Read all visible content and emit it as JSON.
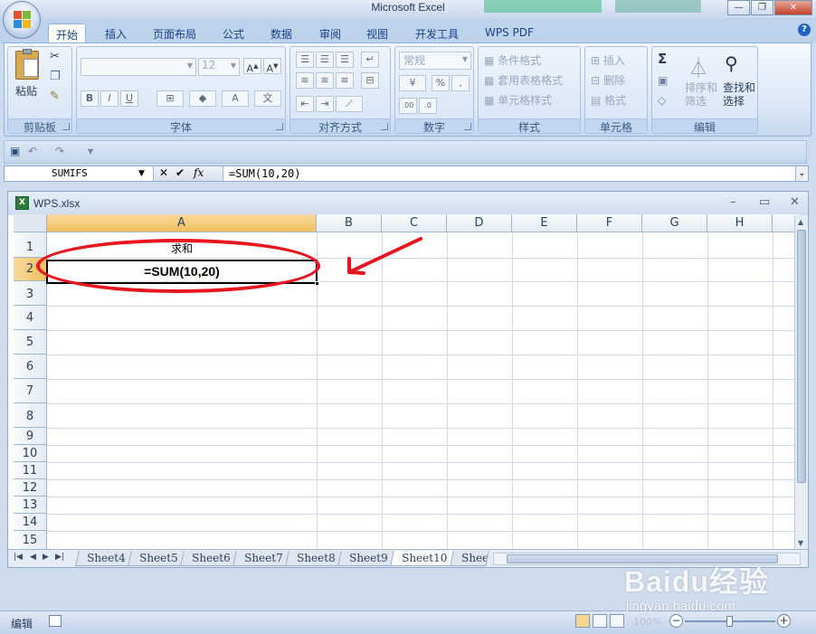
{
  "app": {
    "title": "Microsoft Excel"
  },
  "window_controls": {
    "minimize": "—",
    "restore": "❐",
    "close": "✕"
  },
  "ribbon": {
    "tabs": [
      "开始",
      "插入",
      "页面布局",
      "公式",
      "数据",
      "审阅",
      "视图",
      "开发工具",
      "WPS PDF"
    ],
    "active_tab": "开始",
    "clipboard": {
      "paste_label": "粘贴",
      "group_label": "剪贴板"
    },
    "font": {
      "name_value": "",
      "size_value": "12",
      "group_label": "字体"
    },
    "alignment": {
      "group_label": "对齐方式"
    },
    "number": {
      "format_value": "常规",
      "percent": "%",
      "comma": ",",
      "group_label": "数字"
    },
    "styles": {
      "conditional": "条件格式",
      "table": "套用表格格式",
      "cell": "单元格样式",
      "group_label": "样式"
    },
    "cells": {
      "insert": "插入",
      "delete": "删除",
      "format": "格式",
      "group_label": "单元格"
    },
    "editing": {
      "sum_symbol": "Σ",
      "sort_filter_1": "排序和",
      "sort_filter_2": "筛选",
      "find_select_1": "查找和",
      "find_select_2": "选择",
      "group_label": "编辑"
    }
  },
  "formula_bar": {
    "name_box": "SUMIFS",
    "cancel": "✕",
    "enter": "✔",
    "fx": "fx",
    "content": "=SUM(10,20)"
  },
  "workbook": {
    "title": "WPS.xlsx",
    "columns": [
      "A",
      "B",
      "C",
      "D",
      "E",
      "F",
      "G",
      "H"
    ],
    "rows": [
      "1",
      "2",
      "3",
      "4",
      "5",
      "6",
      "7",
      "8",
      "9",
      "10",
      "11",
      "12",
      "13",
      "14",
      "15"
    ],
    "cells": {
      "A1": "求和",
      "A2": "=SUM(10,20)"
    },
    "sheets": [
      "Sheet4",
      "Sheet5",
      "Sheet6",
      "Sheet7",
      "Sheet8",
      "Sheet9",
      "Sheet10",
      "Shee"
    ],
    "active_sheet": "Sheet10"
  },
  "status_bar": {
    "mode": "编辑",
    "zoom": "100%"
  },
  "watermark": {
    "brand": "Baidu经验",
    "url": "jingyan.baidu.com"
  },
  "colors": {
    "annotation_red": "#e8151f",
    "selected_header": "#f1c15f"
  }
}
